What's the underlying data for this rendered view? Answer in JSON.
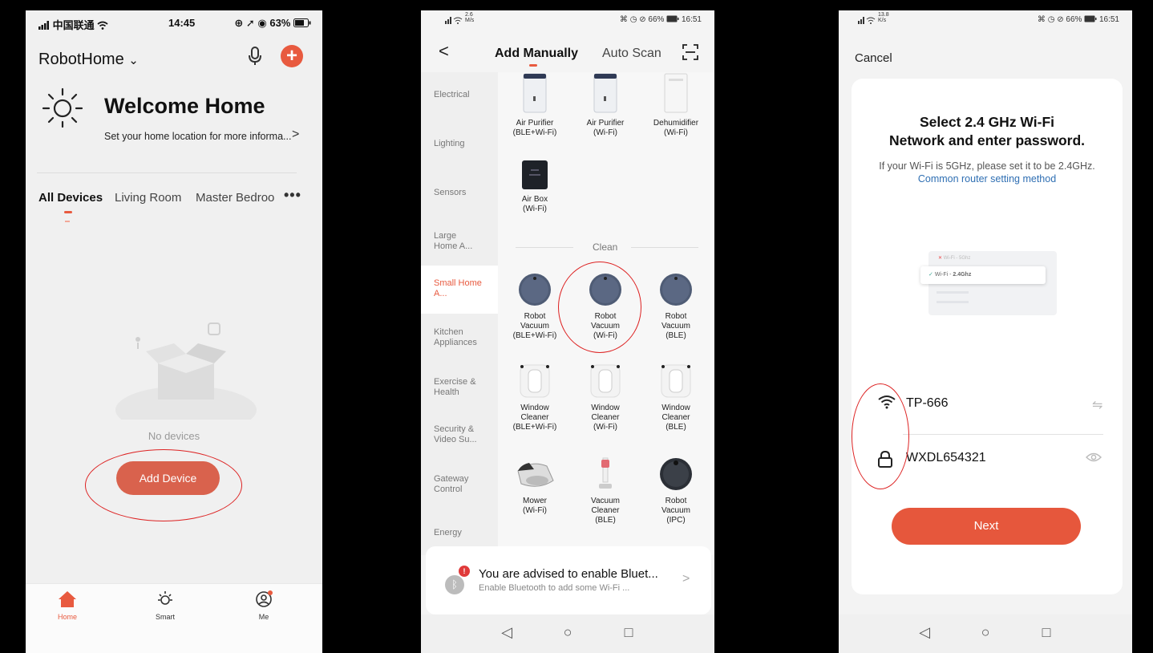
{
  "screen1": {
    "status": {
      "carrier": "中国联通",
      "time": "14:45",
      "battery": "63%"
    },
    "home_title": "RobotHome",
    "home_title_chevron": "⌄",
    "welcome": "Welcome Home",
    "location_info": "Set your home location for more informa...",
    "location_chevron": ">",
    "tabs": [
      "All Devices",
      "Living Room",
      "Master Bedroo"
    ],
    "tabs_more": "•••",
    "no_devices": "No devices",
    "add_device": "Add Device",
    "tabbar": [
      {
        "label": "Home",
        "icon": "home-icon"
      },
      {
        "label": "Smart",
        "icon": "smart-sun-icon"
      },
      {
        "label": "Me",
        "icon": "profile-icon"
      }
    ],
    "accent": "#e85a3f"
  },
  "screen2": {
    "status": {
      "net_speed_value": "2.6",
      "net_speed_unit": "M/s",
      "battery": "66%",
      "time": "16:51"
    },
    "header": {
      "back": "<",
      "tab_manual": "Add Manually",
      "tab_auto": "Auto Scan"
    },
    "categories": [
      "Electrical",
      "Lighting",
      "Sensors",
      "Large Home A...",
      "Small Home A...",
      "Kitchen Appliances",
      "Exercise & Health",
      "Security & Video Su...",
      "Gateway Control",
      "Energy"
    ],
    "active_category": "Small Home A...",
    "top_devices": [
      {
        "line1": "Air Purifier",
        "line2": "(BLE+Wi-Fi)"
      },
      {
        "line1": "Air Purifier",
        "line2": "(Wi-Fi)"
      },
      {
        "line1": "Dehumidifier",
        "line2": "(Wi-Fi)"
      },
      {
        "line1": "Air Box",
        "line2": "(Wi-Fi)"
      }
    ],
    "section_clean": "Clean",
    "clean_devices": [
      {
        "line1": "Robot",
        "line2": "Vacuum",
        "line3": "(BLE+Wi-Fi)"
      },
      {
        "line1": "Robot",
        "line2": "Vacuum",
        "line3": "(Wi-Fi)"
      },
      {
        "line1": "Robot",
        "line2": "Vacuum",
        "line3": "(BLE)"
      },
      {
        "line1": "Window",
        "line2": "Cleaner",
        "line3": "(BLE+Wi-Fi)"
      },
      {
        "line1": "Window",
        "line2": "Cleaner",
        "line3": "(Wi-Fi)"
      },
      {
        "line1": "Window",
        "line2": "Cleaner",
        "line3": "(BLE)"
      },
      {
        "line1": "Mower",
        "line2": "(Wi-Fi)",
        "line3": ""
      },
      {
        "line1": "Vacuum",
        "line2": "Cleaner",
        "line3": "(BLE)"
      },
      {
        "line1": "Robot",
        "line2": "Vacuum",
        "line3": "(IPC)"
      }
    ],
    "bluetooth_banner": {
      "title": "You are advised to enable Bluet...",
      "subtitle": "Enable Bluetooth to add some Wi-Fi ...",
      "badge": "!",
      "chevron": ">"
    },
    "nav": {
      "back": "◁",
      "home": "○",
      "recent": "□"
    }
  },
  "screen3": {
    "status": {
      "net_speed_value": "13.8",
      "net_speed_unit": "K/s",
      "battery": "66%",
      "time": "16:51"
    },
    "cancel": "Cancel",
    "title_line1": "Select 2.4 GHz Wi-Fi",
    "title_line2": "Network and enter password.",
    "desc_text": "If your Wi-Fi is 5GHz, please set it to be 2.4GHz.",
    "desc_link": "Common router setting method",
    "wifi_illustration": {
      "row1": "Wi-Fi - 5Ghz",
      "row2_prefix": "Wi-Fi - ",
      "row2_band": "2.4Ghz"
    },
    "ssid": "TP-666",
    "password": "WXDL654321",
    "next": "Next",
    "nav": {
      "back": "◁",
      "home": "○",
      "recent": "□"
    },
    "accent": "#e6573c"
  }
}
